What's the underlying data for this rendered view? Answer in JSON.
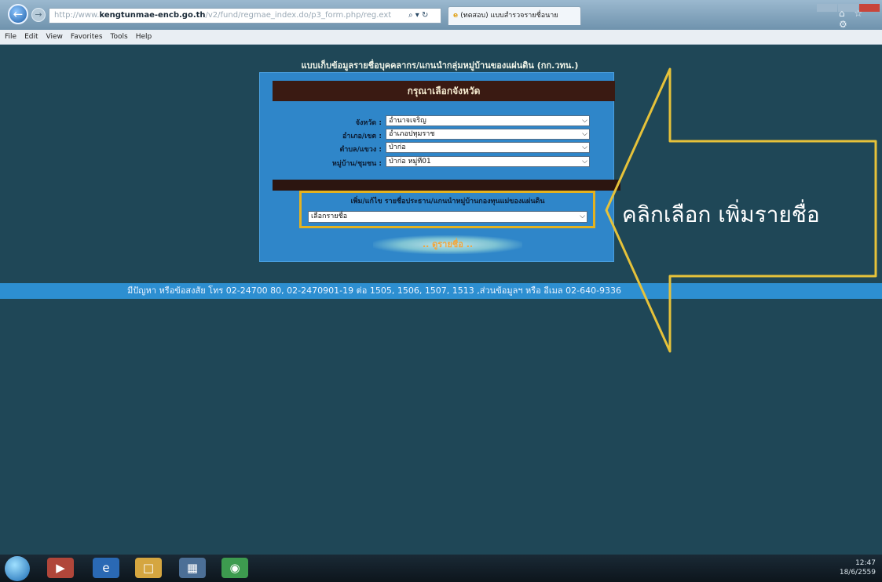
{
  "browser": {
    "address_host": "kengtunmae-encb.go.th",
    "address_prefix": "http://www.",
    "address_path": "/v2/fund/regmae_index.do/p3_form.php/reg.ext",
    "address_actions": "⌕ ▾ ↻",
    "tab_title": "(ทดสอบ) แบบสำรวจรายชื่อนาย",
    "top_right_icons": "⌂ ☆ ⚙"
  },
  "menubar": [
    "File",
    "Edit",
    "View",
    "Favorites",
    "Tools",
    "Help"
  ],
  "page": {
    "title": "แบบเก็บข้อมูลรายชื่อบุคคลากร/แกนนำกลุ่มหมู่บ้านของแผ่นดิน (กก.วทน.)",
    "panel_header": "กรุณาเลือกจังหวัด",
    "rows": [
      {
        "label": "จังหวัด :",
        "value": "อำนาจเจริญ"
      },
      {
        "label": "อำเภอ/เขต :",
        "value": "อำเภอปทุมราช"
      },
      {
        "label": "ตำบล/แขวง :",
        "value": "ป่าก่อ"
      },
      {
        "label": "หมู่บ้าน/ชุมชน :",
        "value": "ป่าก่อ หมู่ที่01"
      }
    ],
    "add_label": "เพิ่ม/แก้ไข รายชื่อประธาน/แกนนำหมู่บ้านกองทุนแม่ของแผ่นดิน",
    "add_select_value": "เลือกรายชื่อ",
    "next_button": "ดูรายชื่อ",
    "footer": "มีปัญหา หรือข้อสงสัย โทร 02-24700 80, 02-2470901-19 ต่อ 1505, 1506, 1507, 1513 ,ส่วนข้อมูลฯ หรือ อีเมล 02-640-9336"
  },
  "annotation": {
    "text": "คลิกเลือก เพิ่มรายชื่อ",
    "color": "#e6c23a"
  },
  "tray": {
    "time": "12:47",
    "date": "18/6/2559"
  },
  "colors": {
    "background": "#1f4757",
    "panel": "#2f86c9",
    "panel_header": "#3a1a12",
    "footer_bar": "#2d8fd1",
    "highlight": "#e4b21f"
  }
}
